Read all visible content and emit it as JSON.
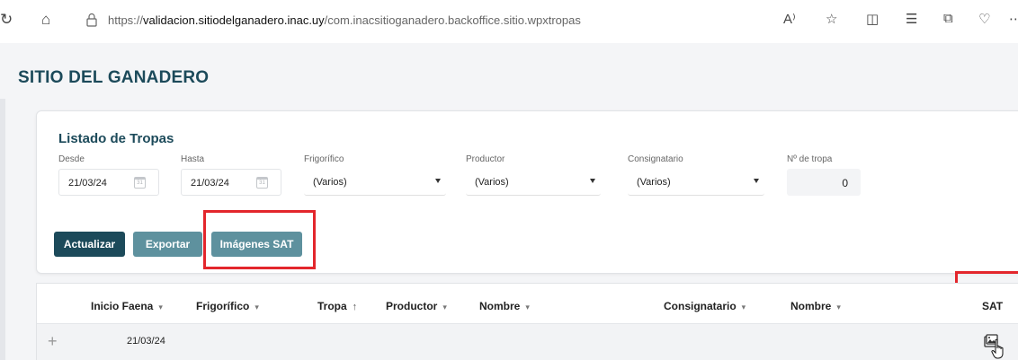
{
  "browser": {
    "url_prefix": "https://",
    "url_host": "validacion.sitiodelganadero.inac.uy",
    "url_path": "/com.inacsitioganadero.backoffice.sitio.wpxtropas",
    "nav_glyphs": [
      "refresh-icon",
      "home-icon"
    ],
    "toolbar_icons": [
      "read-aloud-icon",
      "favorite-icon",
      "split-screen-icon",
      "favorites-bar-icon",
      "collections-icon",
      "extensions-icon",
      "more-icon"
    ]
  },
  "site_title": "SITIO DEL GANADERO",
  "filters": {
    "title": "Listado de Tropas",
    "desde": {
      "label": "Desde",
      "value": "21/03/24"
    },
    "hasta": {
      "label": "Hasta",
      "value": "21/03/24"
    },
    "frigorifico": {
      "label": "Frigorífico",
      "value": "(Varios)"
    },
    "productor": {
      "label": "Productor",
      "value": "(Varios)"
    },
    "consignatario": {
      "label": "Consignatario",
      "value": "(Varios)"
    },
    "tropa": {
      "label": "Nº de tropa",
      "value": "0"
    }
  },
  "buttons": {
    "actualizar": "Actualizar",
    "exportar": "Exportar",
    "imagenes_sat": "Imágenes SAT"
  },
  "grid": {
    "columns": {
      "inicio_faena": "Inicio Faena",
      "frigorifico": "Frigorífico",
      "tropa": "Tropa",
      "productor": "Productor",
      "nombre": "Nombre",
      "consignatario": "Consignatario",
      "nombre2": "Nombre",
      "sat": "SAT"
    },
    "sort_glyph_down": "▾",
    "sort_glyph_up": "↑",
    "rows": [
      {
        "inicio_faena": "21/03/24"
      }
    ]
  },
  "colors": {
    "brand": "#1c4a5a",
    "secondary_button": "#5e919e",
    "highlight_frame": "#e3262c"
  }
}
